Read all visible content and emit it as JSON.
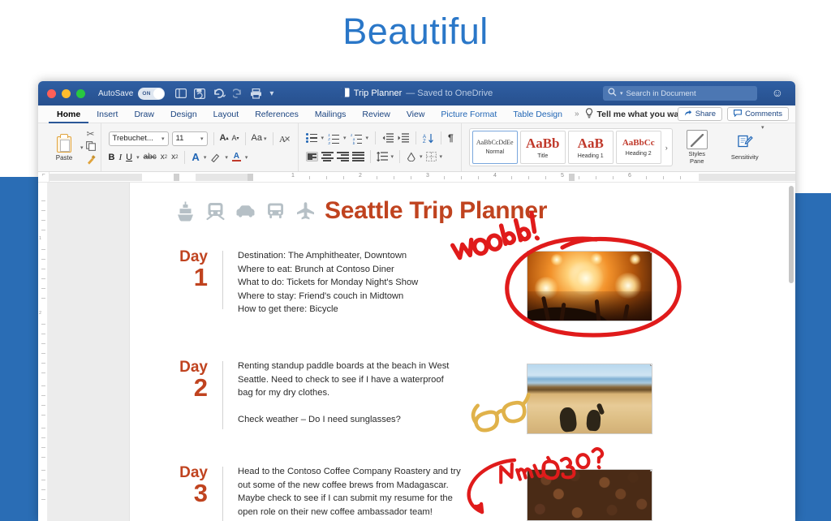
{
  "hero": {
    "text": "Beautiful"
  },
  "colors": {
    "hero_blue": "#2a77c8",
    "backdrop_blue": "#2a6db5",
    "titlebar_blue": "#2b5797",
    "word_red": "#c0431f",
    "ink_red": "#e01b1b",
    "ink_gold": "#e0a33b"
  },
  "window": {
    "titlebar": {
      "autosave_label": "AutoSave",
      "autosave_state": "ON",
      "document_name": "Trip Planner",
      "saved_status": "— Saved to OneDrive",
      "search_placeholder": "Search in Document",
      "icons": [
        "close-dot",
        "minimize-dot",
        "zoom-dot",
        "sidebar-icon",
        "save-icon",
        "undo-icon",
        "redo-icon",
        "print-icon",
        "customize-toolbar-icon",
        "document-icon",
        "search-icon",
        "smiley-icon"
      ]
    },
    "ribbon_tabs": [
      {
        "label": "Home",
        "active": true
      },
      {
        "label": "Insert",
        "active": false
      },
      {
        "label": "Draw",
        "active": false
      },
      {
        "label": "Design",
        "active": false
      },
      {
        "label": "Layout",
        "active": false
      },
      {
        "label": "References",
        "active": false
      },
      {
        "label": "Mailings",
        "active": false
      },
      {
        "label": "Review",
        "active": false
      },
      {
        "label": "View",
        "active": false
      },
      {
        "label": "Picture Format",
        "active": false,
        "contextual": true
      },
      {
        "label": "Table Design",
        "active": false,
        "contextual": true
      }
    ],
    "tabs_overflow": "»",
    "tell_me": "Tell me what you want to do",
    "share_label": "Share",
    "comments_label": "Comments"
  },
  "ribbon": {
    "paste_label": "Paste",
    "clipboard_icons": [
      "paste-icon",
      "cut-icon",
      "copy-icon",
      "format-painter-icon"
    ],
    "font_name": "Trebuchet...",
    "font_size": "11",
    "font_icons": [
      "grow-font-icon",
      "shrink-font-icon",
      "change-case-icon",
      "clear-formatting-icon",
      "bold-icon",
      "italic-icon",
      "underline-icon",
      "strikethrough-icon",
      "subscript-icon",
      "superscript-icon",
      "text-effects-icon",
      "highlight-icon",
      "font-color-icon"
    ],
    "bold": "B",
    "italic": "I",
    "underline": "U",
    "grow_font": "A",
    "shrink_font": "A",
    "change_case": "Aa",
    "paragraph_icons": [
      "bullets-icon",
      "numbering-icon",
      "multilevel-list-icon",
      "decrease-indent-icon",
      "increase-indent-icon",
      "sort-icon",
      "show-marks-icon",
      "align-left-icon",
      "align-center-icon",
      "align-right-icon",
      "justify-icon",
      "line-spacing-icon",
      "shading-icon",
      "borders-icon"
    ],
    "pilcrow": "¶",
    "styles": [
      {
        "preview": "AaBbCcDdEe",
        "name": "Normal",
        "selected": true,
        "red": false
      },
      {
        "preview": "AaBb",
        "name": "Title",
        "selected": false,
        "red": true
      },
      {
        "preview": "AaB",
        "name": "Heading 1",
        "selected": false,
        "red": true
      },
      {
        "preview": "AaBbCc",
        "name": "Heading 2",
        "selected": false,
        "red": true
      }
    ],
    "styles_more": "›",
    "styles_pane_label": "Styles\nPane",
    "styles_pane_label_l1": "Styles",
    "styles_pane_label_l2": "Pane",
    "sensitivity_label": "Sensitivity"
  },
  "ruler": {
    "horizontal_numbers": [
      "1",
      "2",
      "3",
      "4",
      "5",
      "6"
    ],
    "vertical_numbers": [
      "1",
      "2"
    ]
  },
  "document": {
    "title": "Seattle Trip Planner",
    "title_icons": [
      "ship-icon",
      "train-icon",
      "car-icon",
      "bus-icon",
      "airplane-icon"
    ],
    "days": [
      {
        "label": "Day",
        "number": "1",
        "text": "Destination: The Amphitheater, Downtown\nWhere to eat: Brunch at Contoso Diner\nWhat to do: Tickets for Monday Night's Show\nWhere to stay: Friend's couch in Midtown\nHow to get there: Bicycle",
        "photo": "concert-crowd-photo"
      },
      {
        "label": "Day",
        "number": "2",
        "text": "Renting standup paddle boards at the beach in West\nSeattle. Need to check to see if I have a waterproof\nbag for my dry clothes.\n\nCheck weather – Do I need sunglasses?",
        "photo": "beach-shadows-photo"
      },
      {
        "label": "Day",
        "number": "3",
        "text": "Head to the Contoso Coffee Company Roastery and try\nout some of the new coffee brews from Madagascar.\nMaybe check to see if I can submit my resume for the\nopen role on their new coffee ambassador team!",
        "photo": "coffee-beans-photo"
      }
    ],
    "annotations": [
      {
        "name": "woohoo-ink-annotation",
        "text": "Woohoo!",
        "color": "#e01b1b"
      },
      {
        "name": "circle-ink-annotation",
        "text": "",
        "color": "#e01b1b"
      },
      {
        "name": "sunglasses-ink-annotation",
        "text": "",
        "color": "#e0a33b"
      },
      {
        "name": "new-job-ink-annotation",
        "text": "New Job?",
        "color": "#e01b1b"
      },
      {
        "name": "arrow-ink-annotation",
        "text": "",
        "color": "#e01b1b"
      }
    ]
  }
}
